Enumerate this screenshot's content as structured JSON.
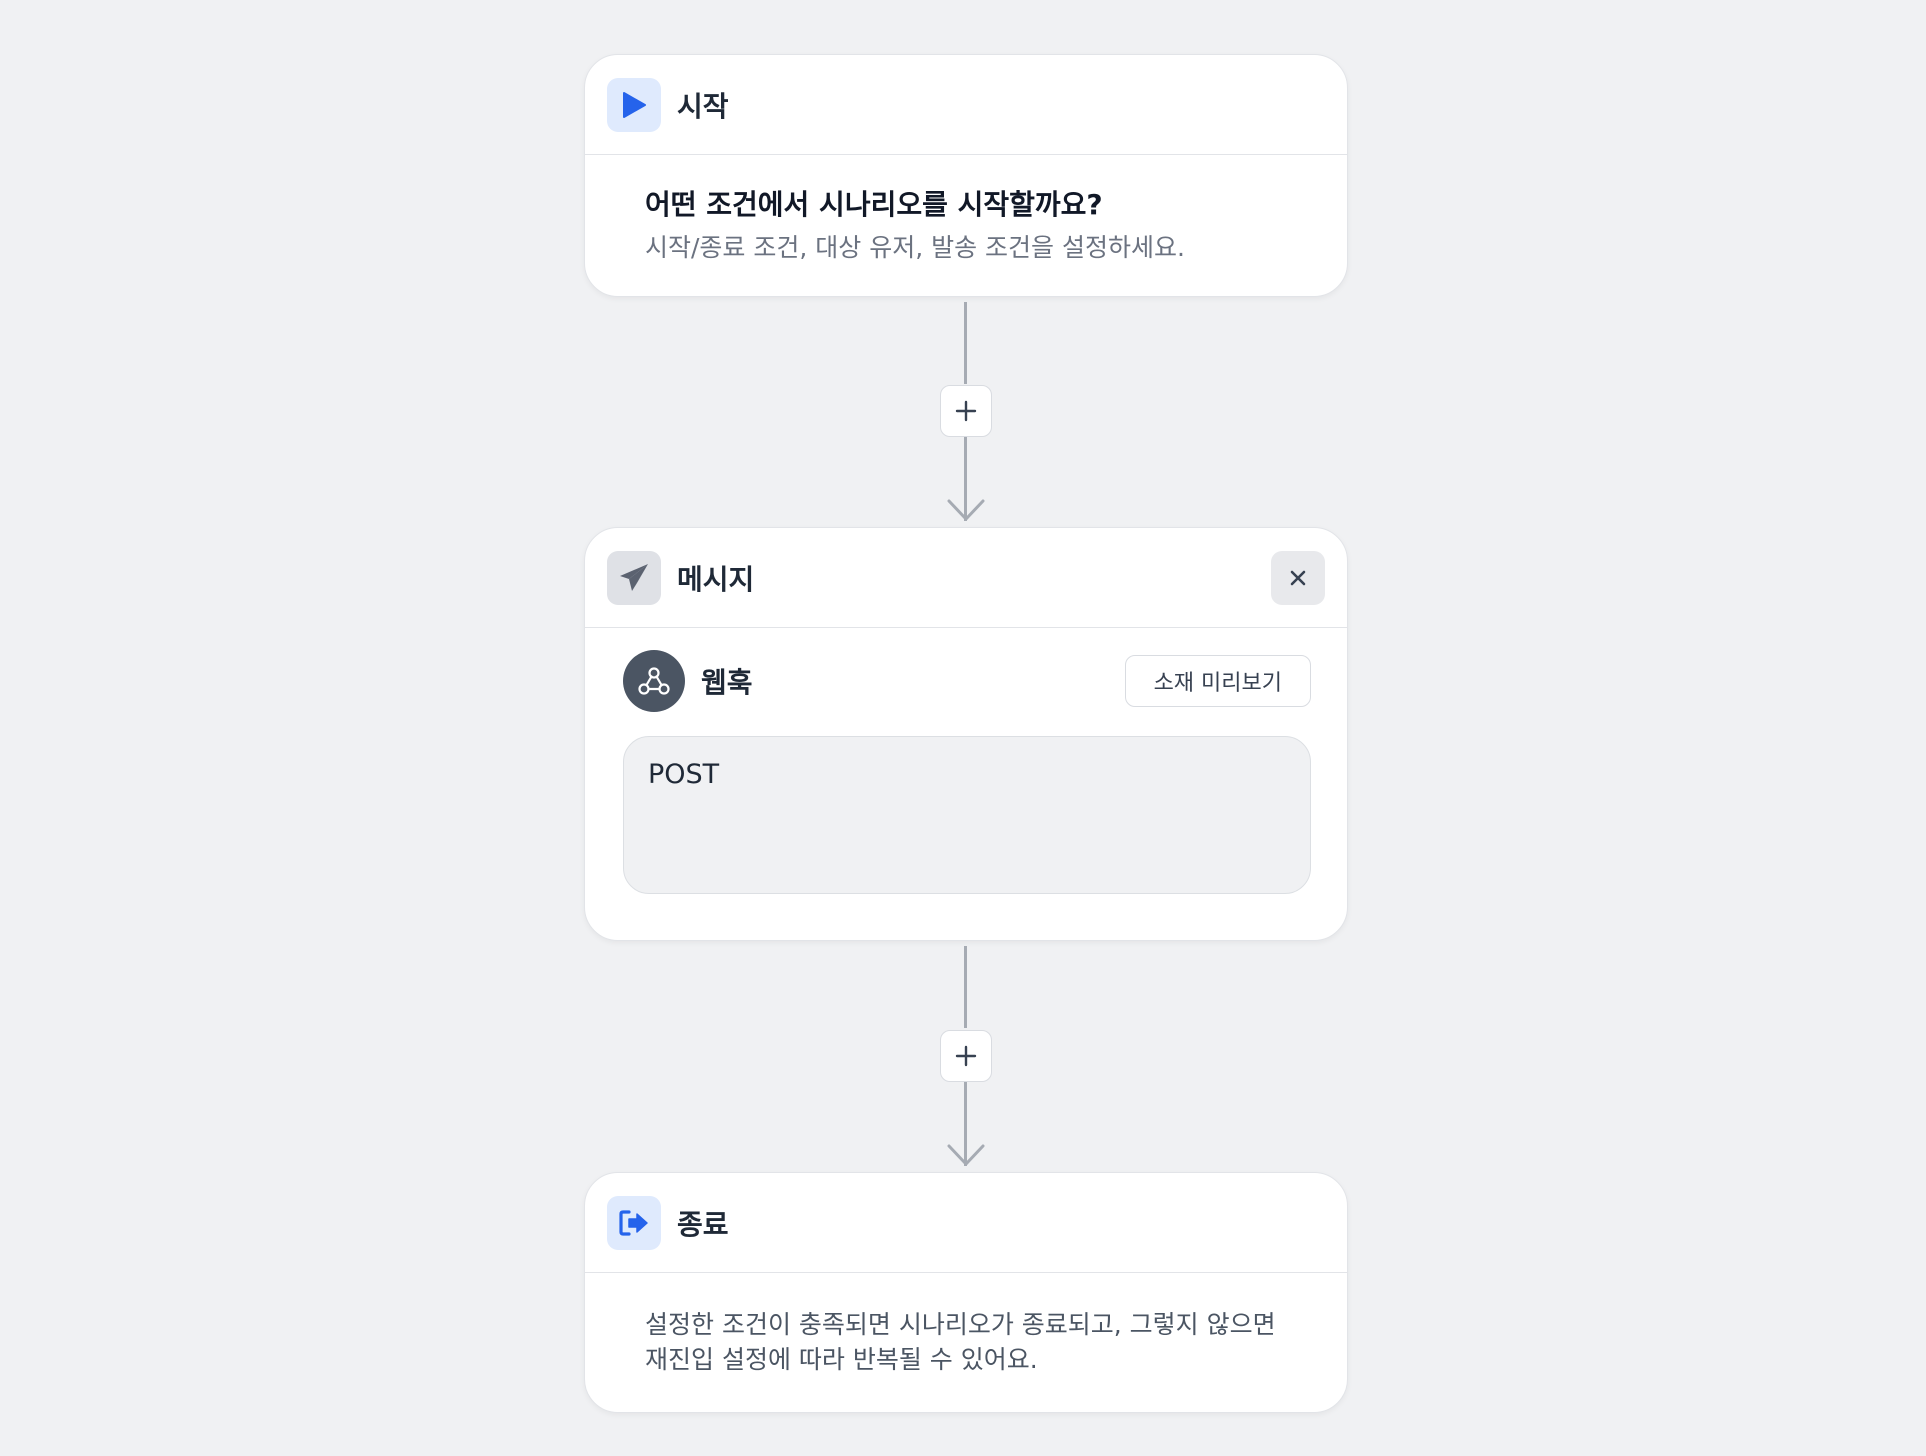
{
  "start": {
    "title": "시작",
    "question": "어떤 조건에서 시나리오를 시작할까요?",
    "description": "시작/종료 조건, 대상 유저, 발송 조건을 설정하세요."
  },
  "message": {
    "title": "메시지",
    "channel": "웹훅",
    "preview_button": "소재 미리보기",
    "method": "POST"
  },
  "end": {
    "title": "종료",
    "description_line1": "설정한 조건이 충족되면 시나리오가 종료되고, 그렇지 않으면",
    "description_line2": "재진입 설정에 따라 반복될 수 있어요."
  },
  "colors": {
    "accent": "#2563eb",
    "background": "#f0f1f3",
    "connector": "#a6abb3"
  },
  "icons": {
    "start": "play-icon",
    "message": "paper-plane-icon",
    "close": "close-icon",
    "channel": "webhook-icon",
    "add": "plus-icon",
    "end": "sign-out-icon"
  }
}
